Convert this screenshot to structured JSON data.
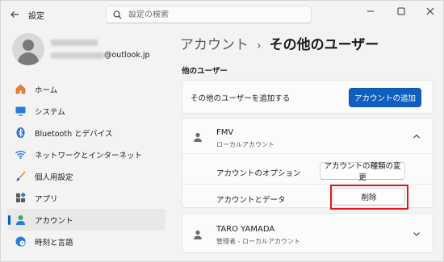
{
  "window": {
    "title": "設定",
    "search_placeholder": "設定の検索"
  },
  "profile": {
    "email_suffix": "@outlook.jp"
  },
  "sidebar": {
    "items": [
      {
        "label": "ホーム",
        "icon": "home-icon"
      },
      {
        "label": "システム",
        "icon": "monitor-icon"
      },
      {
        "label": "Bluetooth とデバイス",
        "icon": "bluetooth-icon"
      },
      {
        "label": "ネットワークとインターネット",
        "icon": "wifi-icon"
      },
      {
        "label": "個人用設定",
        "icon": "brush-icon"
      },
      {
        "label": "アプリ",
        "icon": "apps-icon"
      },
      {
        "label": "アカウント",
        "icon": "account-icon",
        "active": true
      },
      {
        "label": "時刻と言語",
        "icon": "globe-clock-icon"
      }
    ]
  },
  "breadcrumb": {
    "parent": "アカウント",
    "separator": "›",
    "current": "その他のユーザー"
  },
  "main": {
    "section_title": "他のユーザー",
    "add_user": {
      "label": "その他のユーザーを追加する",
      "button": "アカウントの追加"
    },
    "users": [
      {
        "name": "FMV",
        "subtitle": "ローカルアカウント",
        "expanded": true,
        "options_label": "アカウントのオプション",
        "change_type_button": "アカウントの種類の変更",
        "data_label": "アカウントとデータ",
        "delete_button": "削除"
      },
      {
        "name": "TARO YAMADA",
        "subtitle": "管理者 - ローカルアカウント",
        "expanded": false
      }
    ]
  },
  "colors": {
    "accent": "#0f5fc0",
    "highlight": "#e0141e"
  }
}
